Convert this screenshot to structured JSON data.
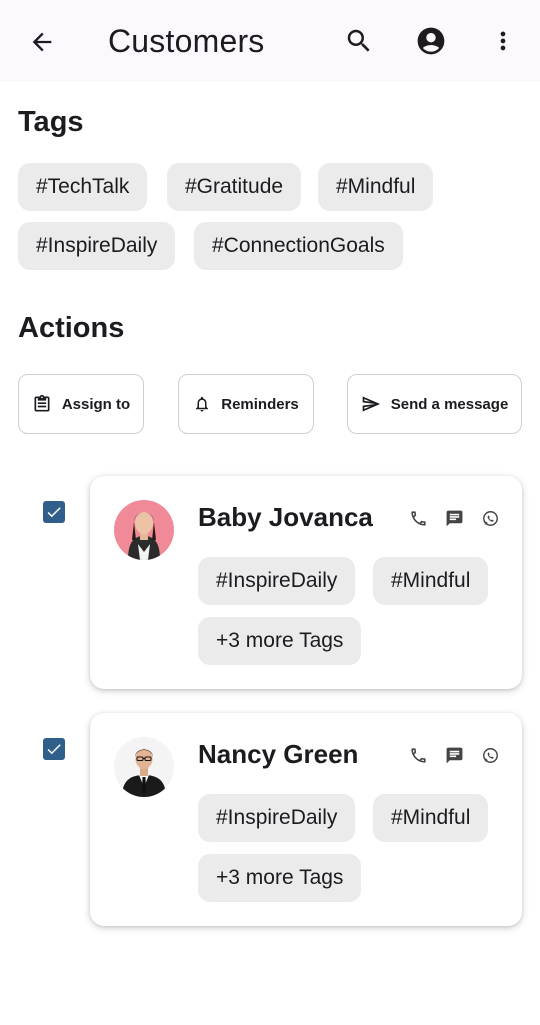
{
  "appbar": {
    "title": "Customers",
    "back_icon": "arrow-back-icon",
    "actions": [
      "search-icon",
      "account-circle-icon",
      "more-vert-icon"
    ]
  },
  "tags_section": {
    "title": "Tags",
    "tags": [
      "#TechTalk",
      "#Gratitude",
      "#Mindful",
      "#InspireDaily",
      "#ConnectionGoals"
    ]
  },
  "actions_section": {
    "title": "Actions",
    "buttons": [
      {
        "label": "Assign to",
        "icon": "clipboard-icon"
      },
      {
        "label": "Reminders",
        "icon": "bell-icon"
      },
      {
        "label": "Send a message",
        "icon": "send-icon"
      }
    ]
  },
  "customers": [
    {
      "name": "Baby Jovanca",
      "checked": true,
      "tags": [
        "#InspireDaily",
        "#Mindful",
        "+3 more Tags"
      ],
      "contact_icons": [
        "phone-icon",
        "message-icon",
        "whatsapp-icon"
      ]
    },
    {
      "name": "Nancy Green",
      "checked": true,
      "tags": [
        "#InspireDaily",
        "#Mindful",
        "+3 more Tags"
      ],
      "contact_icons": [
        "phone-icon",
        "message-icon",
        "whatsapp-icon"
      ]
    }
  ],
  "colors": {
    "appbar_bg": "#fdf7fe",
    "chip_bg": "#ebebeb",
    "checkbox": "#2f5f8a",
    "text": "#1d1b20"
  }
}
